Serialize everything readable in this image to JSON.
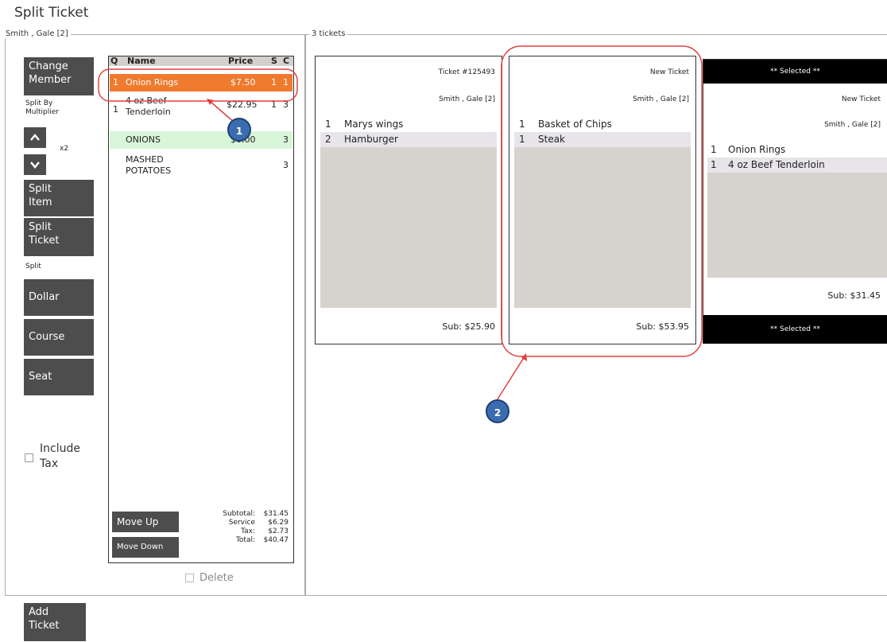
{
  "page_title": "Split Ticket",
  "left_panel": {
    "legend": "Smith , Gale [2]",
    "change_member": [
      "Change",
      "Member"
    ],
    "split_by": [
      "Split By",
      "Multiplier"
    ],
    "multiplier": "x2",
    "split_item": [
      "Split",
      "Item"
    ],
    "split_ticket": [
      "Split",
      "Ticket"
    ],
    "split_label": "Split",
    "dollar": "Dollar",
    "course": "Course",
    "seat": "Seat",
    "include_tax": [
      "Include",
      "Tax"
    ]
  },
  "items_list": {
    "headers": {
      "q": "Q",
      "name": "Name",
      "price": "Price",
      "s": "S",
      "c": "C"
    },
    "rows": [
      {
        "q": "1",
        "name": "Onion Rings",
        "price": "$7.50",
        "s": "1",
        "c": "1"
      },
      {
        "q": "1",
        "name1": "4 oz Beef",
        "name2": "Tenderloin",
        "price": "$22.95",
        "s": "1",
        "c": "3"
      },
      {
        "q": "",
        "name": "ONIONS",
        "price": "$0.00",
        "s": "",
        "c": "3"
      },
      {
        "q": "",
        "name1": "MASHED",
        "name2": "POTATOES",
        "price": "",
        "s": "",
        "c": "3"
      }
    ],
    "move_up": "Move Up",
    "move_down": "Move Down",
    "totals": {
      "subtotal_label": "Subtotal:",
      "subtotal": "$31.45",
      "service_label": "Service",
      "service": "$6.29",
      "tax_label": "Tax:",
      "tax": "$2.73",
      "total_label": "Total:",
      "total": "$40.47"
    },
    "delete": "Delete"
  },
  "tickets_panel": {
    "legend": "3 tickets",
    "tickets": [
      {
        "header": "Ticket #125493",
        "member": "Smith , Gale [2]",
        "lines": [
          {
            "q": "1",
            "name": "Marys wings"
          },
          {
            "q": "2",
            "name": "Hamburger"
          }
        ],
        "sub": "Sub: $25.90"
      },
      {
        "header": "New Ticket",
        "member": "Smith , Gale [2]",
        "lines": [
          {
            "q": "1",
            "name": "Basket of Chips"
          },
          {
            "q": "1",
            "name": "Steak"
          }
        ],
        "sub": "Sub: $53.95"
      },
      {
        "selected": "** Selected **",
        "header": "New Ticket",
        "member": "Smith , Gale [2]",
        "lines": [
          {
            "q": "1",
            "name": "Onion Rings"
          },
          {
            "q": "1",
            "name": "4 oz Beef Tenderloin"
          }
        ],
        "sub": "Sub: $31.45"
      }
    ]
  },
  "add_ticket": [
    "Add",
    "Ticket"
  ],
  "callouts": [
    "1",
    "2"
  ],
  "colors": {
    "button": "#4d4d4d",
    "selected_row": "#f07a2d",
    "highlight_row": "#d8f6d8",
    "annotation": "#e0403f",
    "callout": "#3a6db0"
  }
}
